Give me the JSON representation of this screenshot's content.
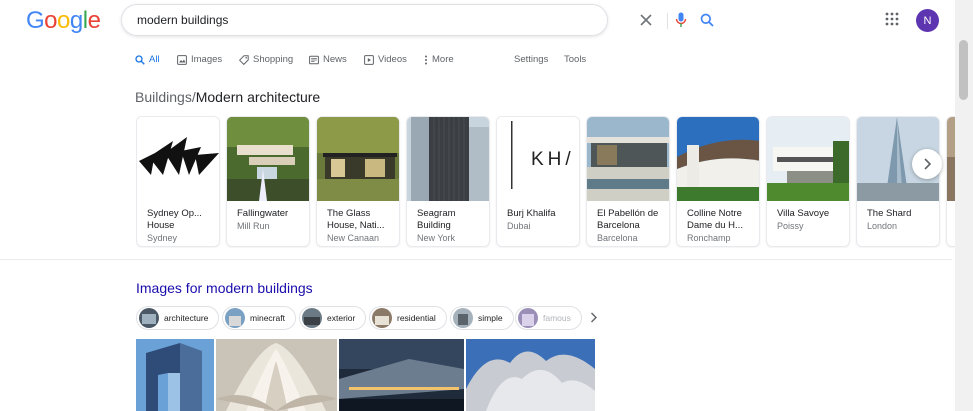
{
  "header": {
    "logo_letters": [
      "G",
      "o",
      "o",
      "g",
      "l",
      "e"
    ],
    "logo_colors": [
      "#4285F4",
      "#EA4335",
      "#FBBC05",
      "#4285F4",
      "#34A853",
      "#EA4335"
    ],
    "search": {
      "value": "modern buildings"
    },
    "avatar_letter": "N",
    "avatar_color": "#5e35b1"
  },
  "tabs": [
    {
      "label": "All",
      "icon": "search-icon",
      "active": true
    },
    {
      "label": "Images",
      "icon": "image-icon"
    },
    {
      "label": "Shopping",
      "icon": "tag-icon"
    },
    {
      "label": "News",
      "icon": "news-icon"
    },
    {
      "label": "Videos",
      "icon": "play-icon"
    },
    {
      "label": "More",
      "icon": "more-vert-icon"
    },
    {
      "label": "Settings"
    },
    {
      "label": "Tools"
    }
  ],
  "knowledge": {
    "category": "Buildings",
    "separator": "/",
    "title": "Modern architecture"
  },
  "carousel": [
    {
      "title": "Sydney Op... House",
      "subtitle": "Sydney"
    },
    {
      "title": "Fallingwater",
      "subtitle": "Mill Run"
    },
    {
      "title": "The Glass House, Nati...",
      "subtitle": "New Canaan"
    },
    {
      "title": "Seagram Building",
      "subtitle": "New York"
    },
    {
      "title": "Burj Khalifa",
      "subtitle": "Dubai",
      "thumb_text": "KH/"
    },
    {
      "title": "El Pabellón de Barcelona",
      "subtitle": "Barcelona"
    },
    {
      "title": "Colline Notre Dame du H...",
      "subtitle": "Ronchamp"
    },
    {
      "title": "Villa Savoye",
      "subtitle": "Poissy"
    },
    {
      "title": "The Shard",
      "subtitle": "London"
    }
  ],
  "images": {
    "heading": "Images for modern buildings",
    "chips": [
      "architecture",
      "minecraft",
      "exterior",
      "residential",
      "simple",
      "famous"
    ]
  },
  "accent_color": "#1a73e8",
  "link_color": "#1a0dab"
}
